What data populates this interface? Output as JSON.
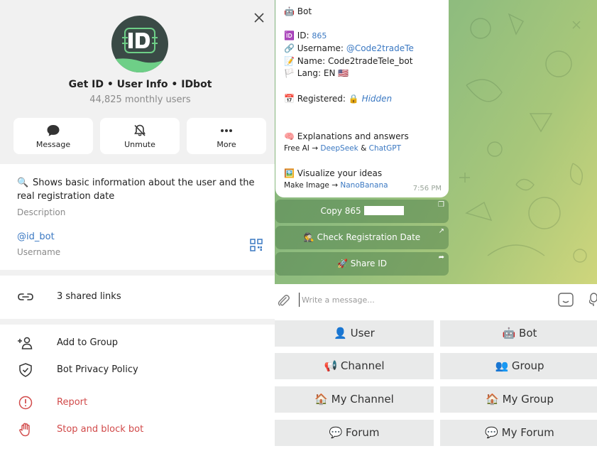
{
  "profile": {
    "name": "Get ID • User Info • IDbot",
    "monthly_users": "44,825 monthly users",
    "actions": [
      {
        "label": "Message"
      },
      {
        "label": "Unmute"
      },
      {
        "label": "More"
      }
    ]
  },
  "info": {
    "description_icon": "🔍",
    "description": "Shows basic information about the user and the real registration date",
    "description_label": "Description",
    "username": "@id_bot",
    "username_label": "Username"
  },
  "shared_links": "3 shared links",
  "menu": {
    "add_to_group": "Add to Group",
    "privacy_policy": "Bot Privacy Policy",
    "report": "Report",
    "stop_block": "Stop and block bot"
  },
  "message": {
    "header": "🤖 Bot",
    "id_label": "🆔 ID:",
    "id_value": "865",
    "username_label": "🔗 Username:",
    "username_value": "@Code2tradeTe",
    "name_label": "📝 Name:",
    "name_value": "Code2tradeTele_bot",
    "lang_label": "🏳️ Lang:",
    "lang_value": "EN 🇺🇸",
    "registered_label": "📅 Registered:",
    "registered_lock": "🔒",
    "registered_value": "Hidden",
    "explain_title": "🧠 Explanations and answers",
    "explain_prefix": "Free AI →",
    "explain_link1": "DeepSeek",
    "explain_amp": "&",
    "explain_link2": "ChatGPT",
    "visualize_title": "🖼️ Visualize your ideas",
    "visualize_prefix": "Make Image →",
    "visualize_link": "NanoBanana",
    "time": "7:56 PM"
  },
  "inline_buttons": [
    {
      "label": "Copy 865"
    },
    {
      "label": "🕵️ Check Registration Date"
    },
    {
      "label": "🚀 Share ID"
    }
  ],
  "compose": {
    "placeholder": "Write a message..."
  },
  "keyboard": [
    {
      "label": "👤 User"
    },
    {
      "label": "🤖 Bot"
    },
    {
      "label": "📢 Channel"
    },
    {
      "label": "👥 Group"
    },
    {
      "label": "🏠 My Channel"
    },
    {
      "label": "🏠 My Group"
    },
    {
      "label": "💬 Forum"
    },
    {
      "label": "💬 My Forum"
    }
  ],
  "colors": {
    "accent": "#3a78c2",
    "danger": "#d14a4a",
    "avatar_bg": "#3a4a46",
    "avatar_accent": "#6ecf87"
  }
}
